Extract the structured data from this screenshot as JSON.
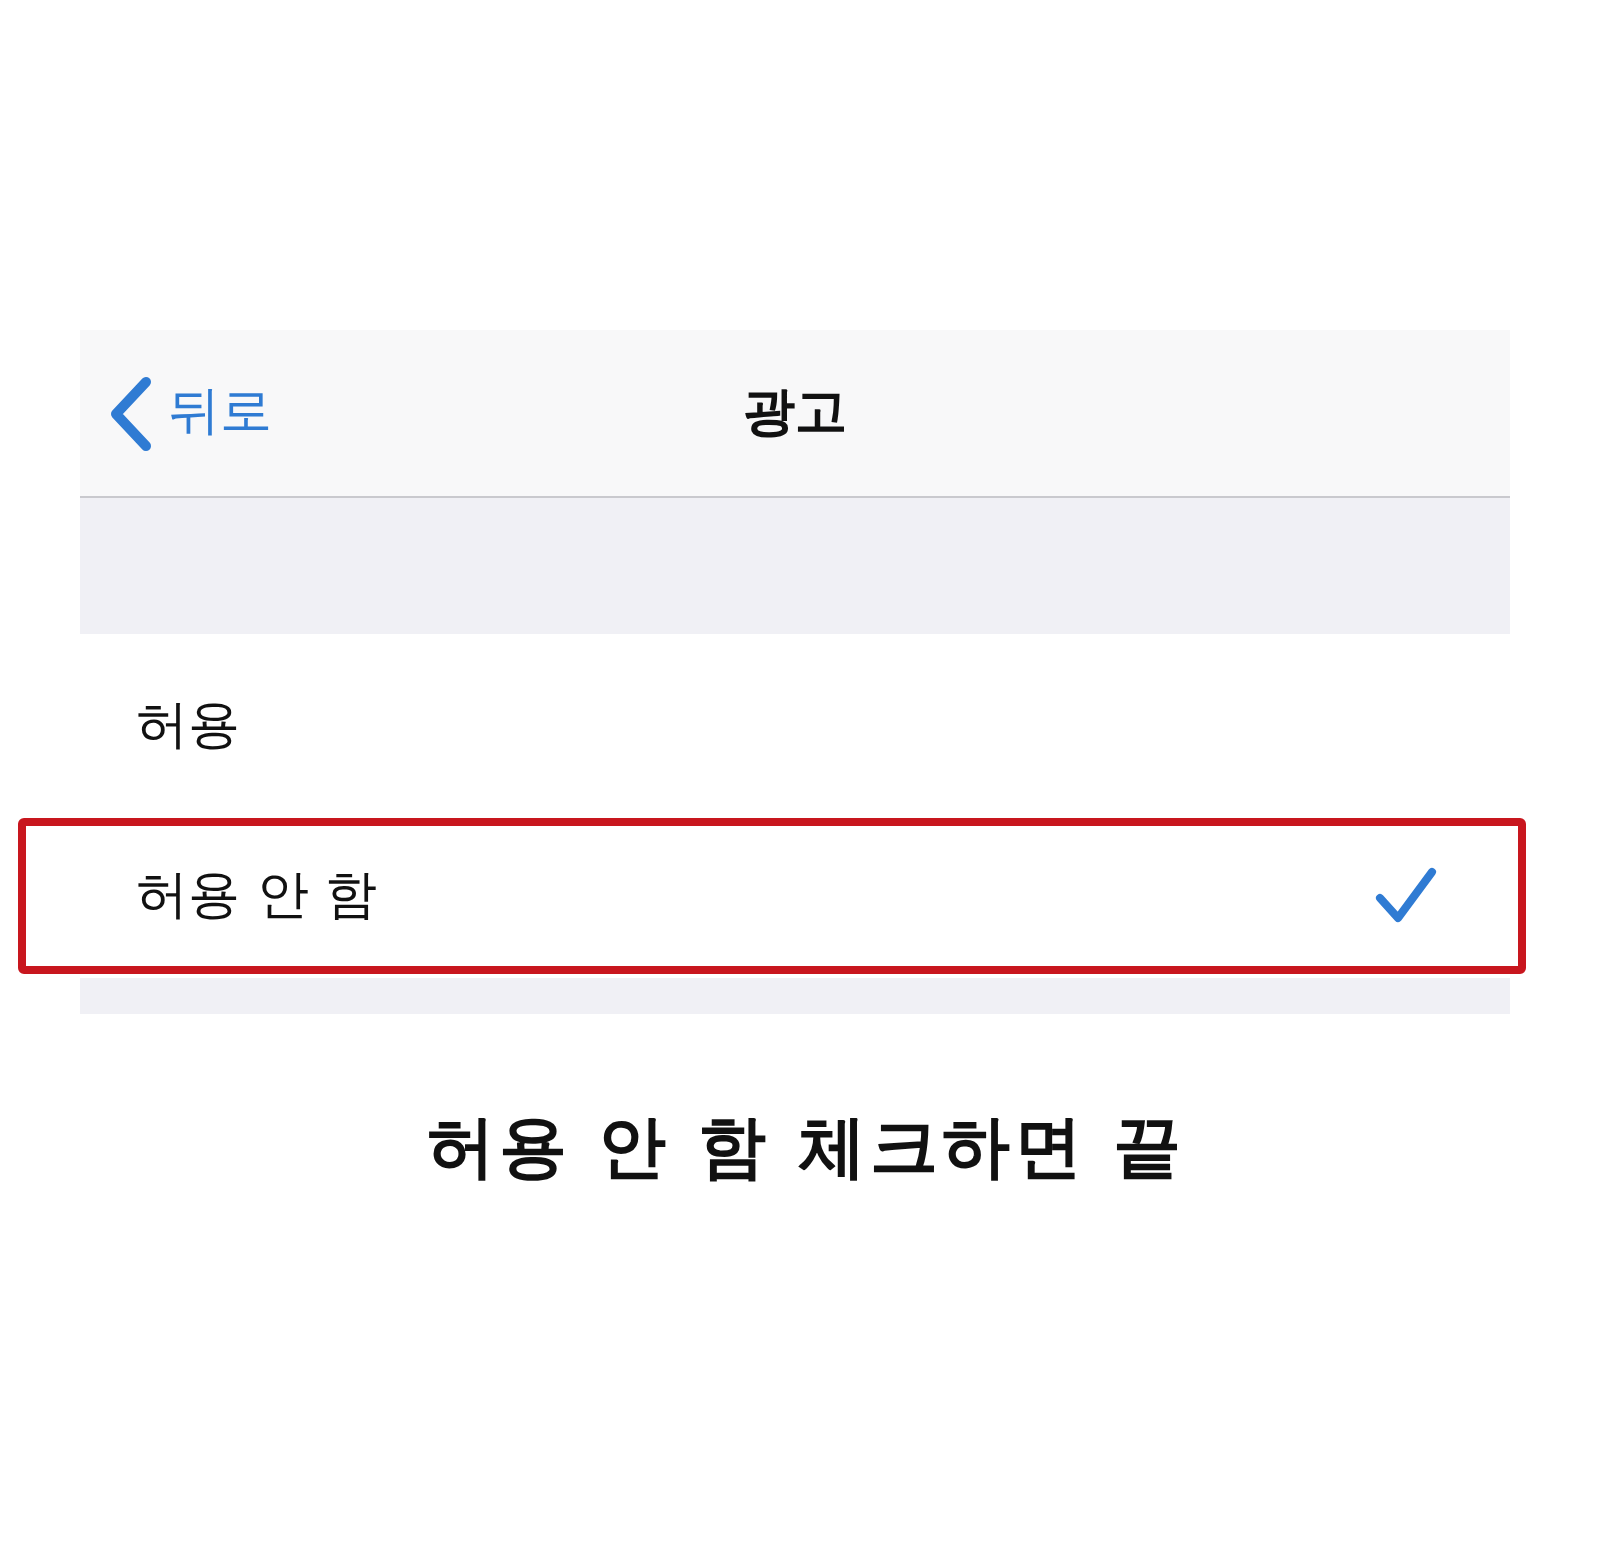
{
  "nav": {
    "back_label": "뒤로",
    "title": "광고"
  },
  "options": [
    {
      "label": "허용",
      "selected": false,
      "highlighted": false
    },
    {
      "label": "허용 안 함",
      "selected": true,
      "highlighted": true
    }
  ],
  "caption": "허용 안 함 체크하면 끝"
}
